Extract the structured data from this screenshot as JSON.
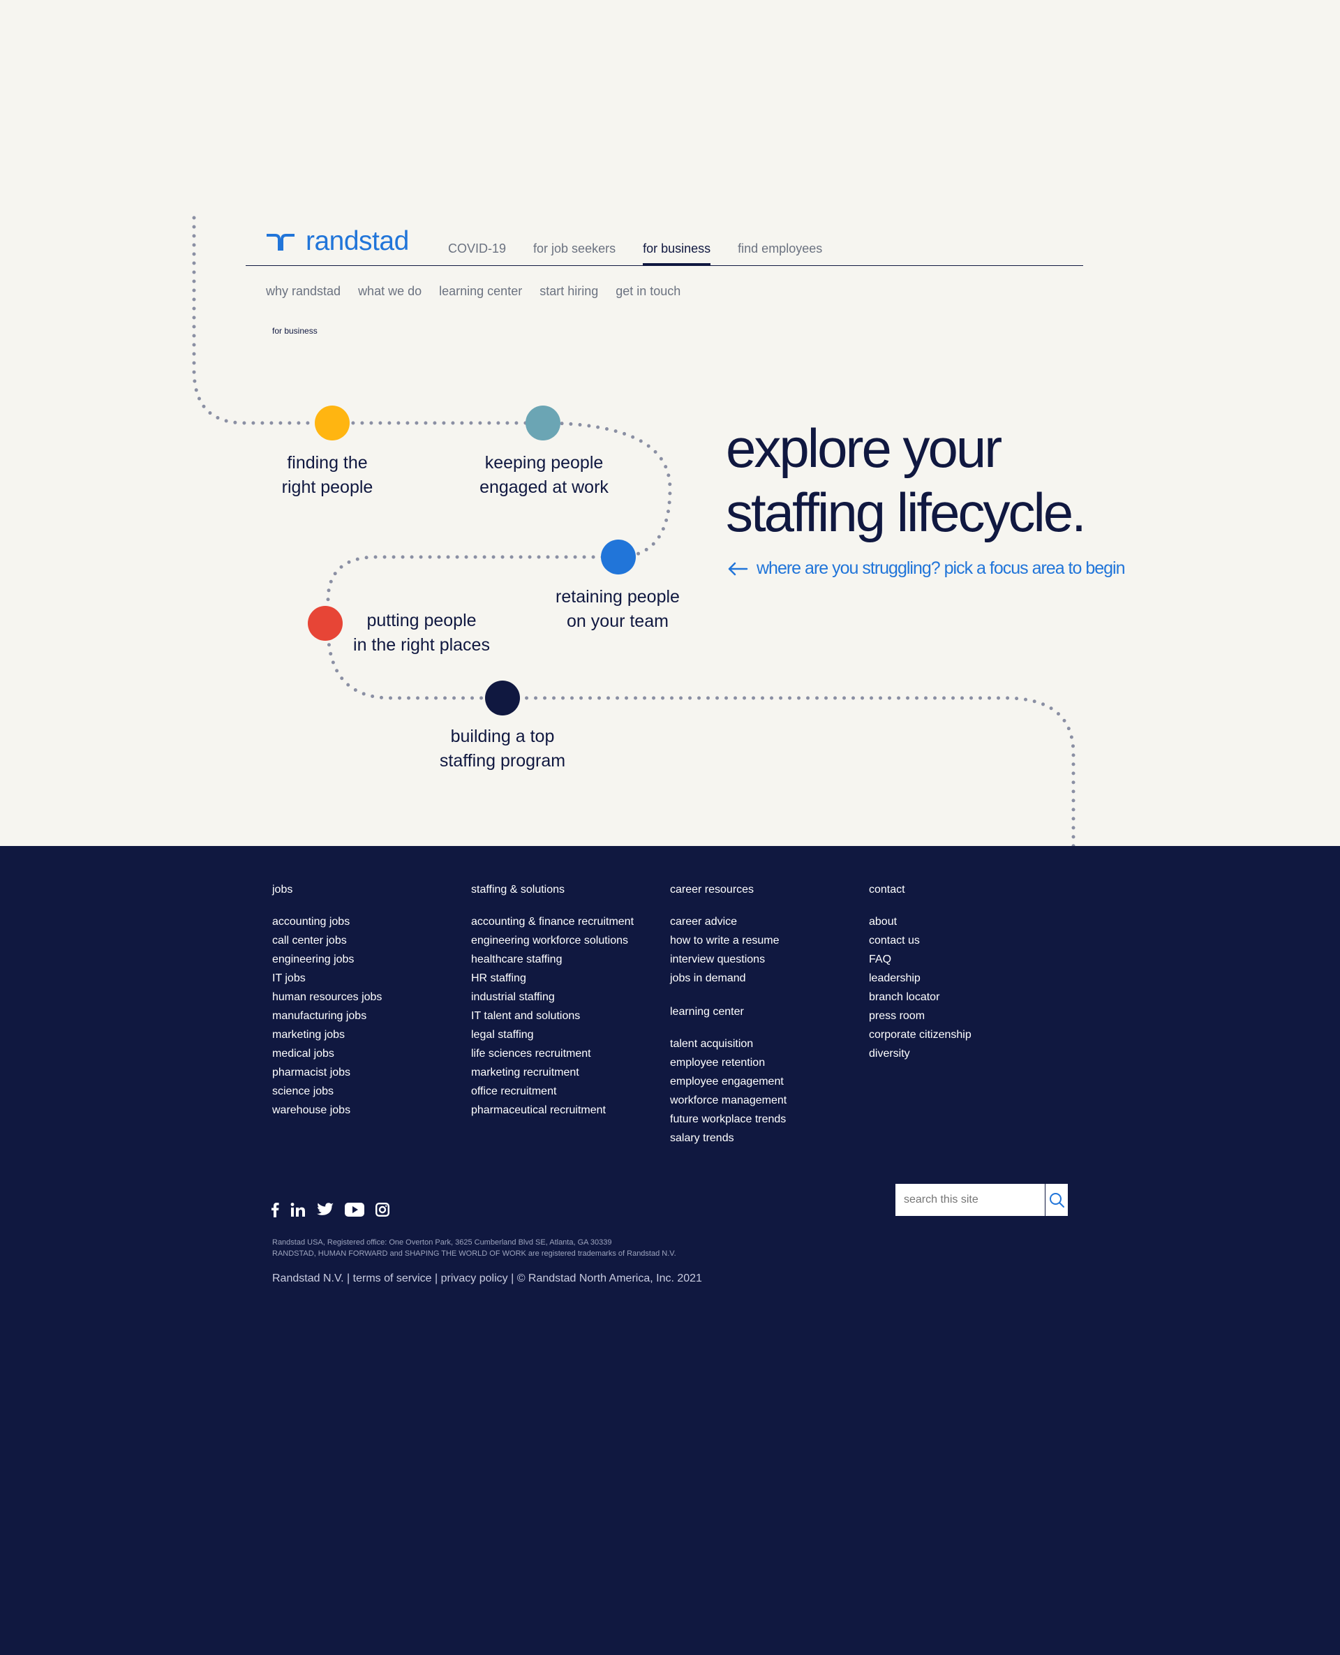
{
  "brand": {
    "name": "randstad",
    "color": "#2175d9"
  },
  "main_nav": [
    "COVID-19",
    "for job seekers",
    "for business",
    "find employees"
  ],
  "main_nav_active": "for business",
  "sub_nav": [
    "why randstad",
    "what we do",
    "learning center",
    "start hiring",
    "get in touch"
  ],
  "breadcrumb": "for business",
  "lifecycle": {
    "nodes": [
      {
        "line1": "finding the",
        "line2": "right people",
        "color": "#ffb511"
      },
      {
        "line1": "keeping people",
        "line2": "engaged at work",
        "color": "#6ba5b4"
      },
      {
        "line1": "retaining people",
        "line2": "on your team",
        "color": "#2175d9"
      },
      {
        "line1": "putting people",
        "line2": "in the right places",
        "color": "#e74536"
      },
      {
        "line1": "building a top",
        "line2": "staffing program",
        "color": "#101840"
      }
    ]
  },
  "hero": {
    "title_line1": "explore your",
    "title_line2": "staffing lifecycle.",
    "subtitle": "where are you struggling? pick a focus area to begin"
  },
  "footer": {
    "jobs": {
      "heading": "jobs",
      "links": [
        "accounting jobs",
        "call center jobs",
        "engineering jobs",
        "IT jobs",
        "human resources jobs",
        "manufacturing jobs",
        "marketing jobs",
        "medical jobs",
        "pharmacist jobs",
        "science jobs",
        "warehouse jobs"
      ]
    },
    "staffing": {
      "heading": "staffing & solutions",
      "links": [
        "accounting & finance recruitment",
        "engineering workforce solutions",
        "healthcare staffing",
        "HR staffing",
        "industrial staffing",
        "IT talent and solutions",
        "legal staffing",
        "life sciences recruitment",
        "marketing recruitment",
        "office recruitment",
        "pharmaceutical recruitment"
      ]
    },
    "career": {
      "heading": "career resources",
      "links": [
        "career advice",
        "how to write a resume",
        "interview questions",
        "jobs in demand"
      ],
      "subheading": "learning center",
      "sublinks": [
        "talent acquisition",
        "employee retention",
        "employee engagement",
        "workforce management",
        "future workplace trends",
        "salary trends"
      ]
    },
    "contact": {
      "heading": "contact",
      "links": [
        "about",
        "contact us",
        "FAQ",
        "leadership",
        "branch locator",
        "press room",
        "corporate citizenship",
        "diversity"
      ]
    },
    "social": [
      "facebook-icon",
      "linkedin-icon",
      "twitter-icon",
      "youtube-icon",
      "instagram-icon"
    ],
    "search_placeholder": "search this site",
    "legal_line1": "Randstad USA, Registered office: One Overton Park, 3625 Cumberland Blvd SE, Atlanta, GA 30339",
    "legal_line2": "RANDSTAD, HUMAN FORWARD and SHAPING THE WORLD OF WORK are registered trademarks of Randstad N.V.",
    "bottom_links": [
      "Randstad N.V.",
      "terms of service",
      "privacy policy",
      "© Randstad North America, Inc. 2021"
    ],
    "separator": " | "
  },
  "colors": {
    "navy": "#101840",
    "background": "#f6f5f0",
    "blue": "#2175d9"
  }
}
